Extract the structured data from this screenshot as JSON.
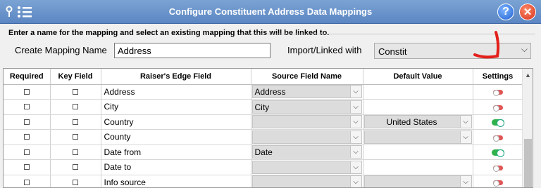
{
  "window": {
    "title": "Configure Constituent Address Data Mappings",
    "close_symbol": "✕",
    "help_symbol": "?"
  },
  "form": {
    "instruction": "Enter a name for the mapping and select an existing mapping that this will be linked to.",
    "name_label": "Create Mapping Name",
    "name_value": "Address",
    "import_label": "Import/Linked with",
    "import_value": "Constit"
  },
  "grid": {
    "headers": [
      "Required",
      "Key Field",
      "Raiser's Edge Field",
      "Source Field Name",
      "Default Value",
      "Settings"
    ],
    "rows": [
      {
        "field": "Address",
        "source": "Address",
        "default_value": "",
        "default_is_combo": false,
        "setting": "off"
      },
      {
        "field": "City",
        "source": "City",
        "default_value": "",
        "default_is_combo": false,
        "setting": "off"
      },
      {
        "field": "Country",
        "source": "",
        "default_value": "United States",
        "default_is_combo": true,
        "setting": "on"
      },
      {
        "field": "County",
        "source": "",
        "default_value": "",
        "default_is_combo": true,
        "setting": "off"
      },
      {
        "field": "Date from",
        "source": "Date",
        "default_value": "",
        "default_is_combo": false,
        "setting": "on"
      },
      {
        "field": "Date to",
        "source": "",
        "default_value": "",
        "default_is_combo": false,
        "setting": "off"
      },
      {
        "field": "Info source",
        "source": "",
        "default_value": "",
        "default_is_combo": true,
        "setting": "off"
      }
    ]
  },
  "colors": {
    "title_bar": "#5b86c2",
    "toggle_off": "#e05555",
    "toggle_on": "#2fb14c",
    "annotation": "#e3201b"
  },
  "icons": [
    "pin-icon",
    "menu-icon",
    "help-icon",
    "close-icon",
    "checkbox-icon",
    "chevron-down-icon",
    "toggle-icon"
  ]
}
